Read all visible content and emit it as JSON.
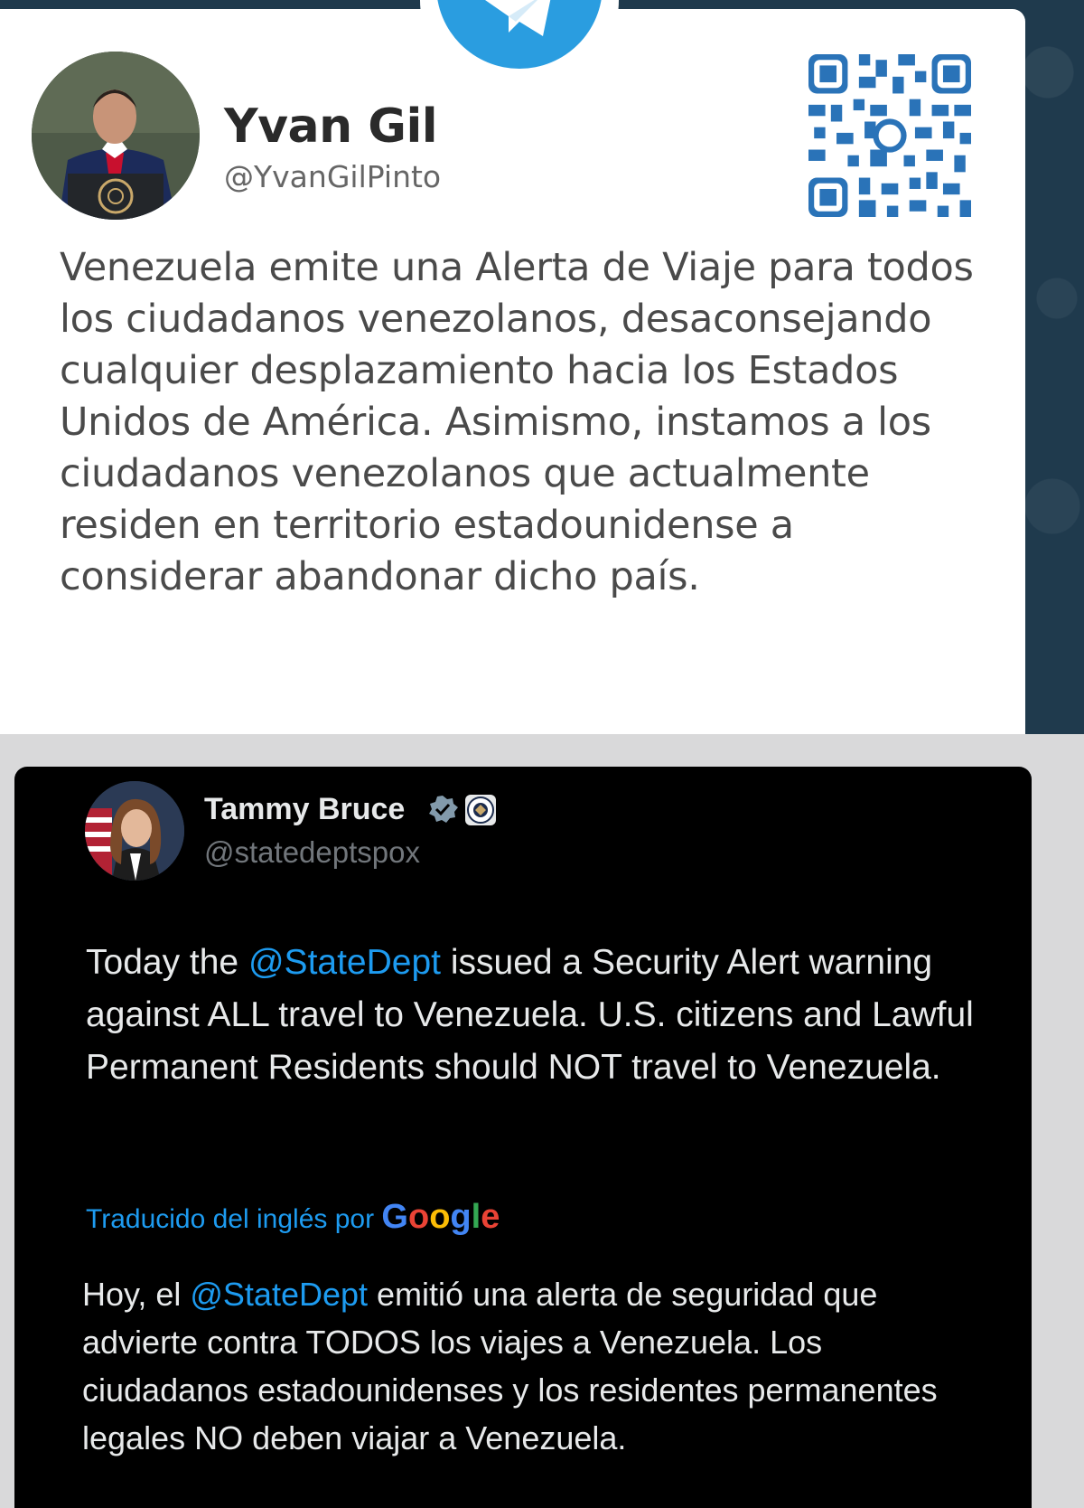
{
  "top_post": {
    "author_name": "Yvan Gil",
    "author_handle": "@YvanGilPinto",
    "body": "Venezuela emite una Alerta de Viaje para todos los ciudadanos venezolanos, desaconsejando cualquier desplazamiento hacia los Estados Unidos de América. Asimismo, instamos a los ciudadanos venezolanos que actualmente residen en territorio estadounidense a considerar abandonar dicho país.",
    "badge_icon": "telegram-logo-icon",
    "qr_icon": "qr-code-icon"
  },
  "bottom_post": {
    "author_name": "Tammy Bruce",
    "author_handle": "@statedeptspox",
    "body_prefix": "Today the ",
    "body_mention": "@StateDept",
    "body_suffix": " issued a Security Alert warning against ALL travel to Venezuela. U.S. citizens and Lawful Permanent Residents should NOT travel to Venezuela.",
    "translated_label": "Traducido del inglés por ",
    "translated_brand": [
      "G",
      "o",
      "o",
      "g",
      "l",
      "e"
    ],
    "translation_prefix": "Hoy, el ",
    "translation_mention": "@StateDept",
    "translation_suffix": " emitió una alerta de seguridad que advierte contra TODOS los viajes a Venezuela. Los ciudadanos estadounidenses y los residentes permanentes legales NO deben viajar a Venezuela."
  },
  "colors": {
    "mention": "#1d9bf0",
    "telegram_blue": "#2a9de0",
    "google": [
      "#4285f4",
      "#ea4335",
      "#fbbc05",
      "#4285f4",
      "#34a853",
      "#ea4335"
    ]
  }
}
